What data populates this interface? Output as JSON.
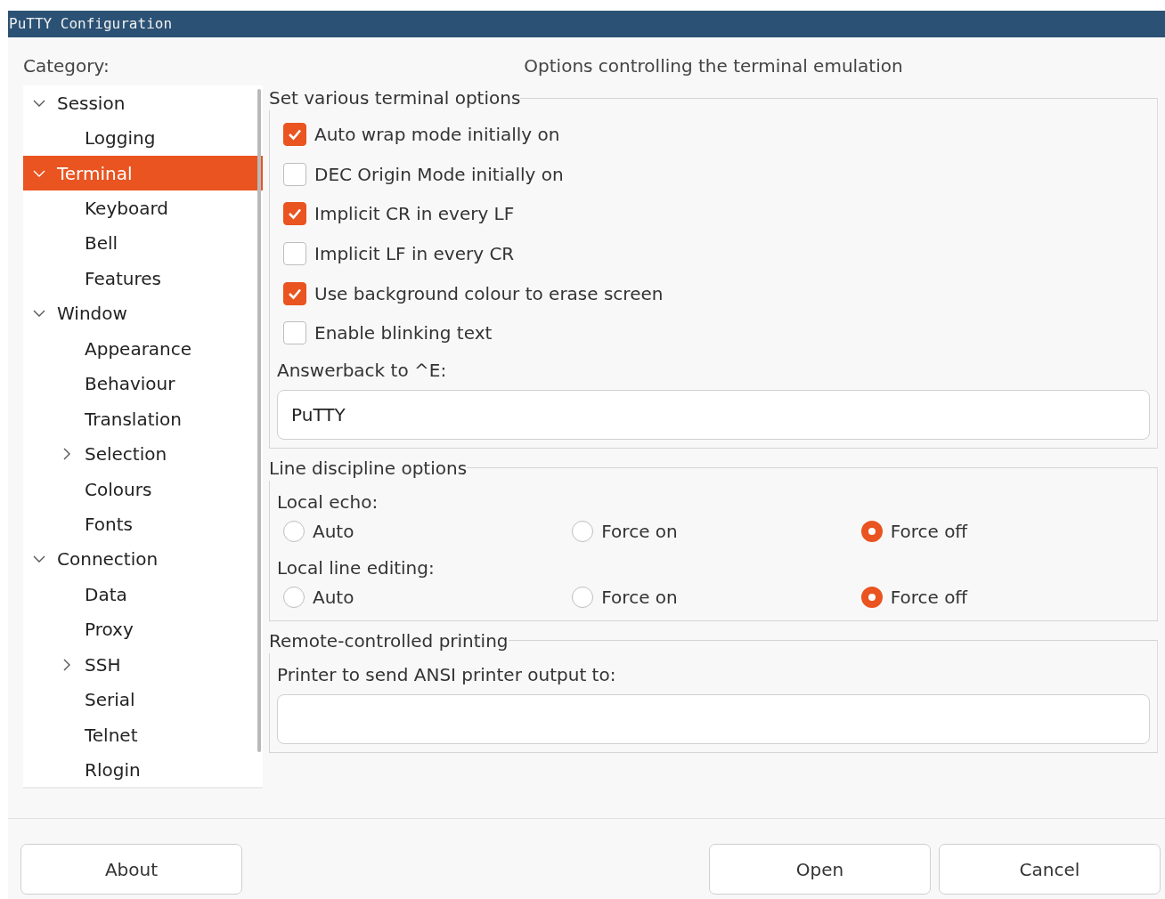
{
  "window": {
    "title": "PuTTY Configuration"
  },
  "category": {
    "label": "Category:",
    "items": [
      {
        "label": "Session",
        "selected": false,
        "expanded": true,
        "children": [
          {
            "label": "Logging",
            "selected": false
          }
        ]
      },
      {
        "label": "Terminal",
        "selected": true,
        "expanded": true,
        "children": [
          {
            "label": "Keyboard",
            "selected": false
          },
          {
            "label": "Bell",
            "selected": false
          },
          {
            "label": "Features",
            "selected": false
          }
        ]
      },
      {
        "label": "Window",
        "selected": false,
        "expanded": true,
        "children": [
          {
            "label": "Appearance",
            "selected": false
          },
          {
            "label": "Behaviour",
            "selected": false
          },
          {
            "label": "Translation",
            "selected": false
          },
          {
            "label": "Selection",
            "selected": false,
            "expanded": false
          },
          {
            "label": "Colours",
            "selected": false
          },
          {
            "label": "Fonts",
            "selected": false
          }
        ]
      },
      {
        "label": "Connection",
        "selected": false,
        "expanded": true,
        "children": [
          {
            "label": "Data",
            "selected": false
          },
          {
            "label": "Proxy",
            "selected": false
          },
          {
            "label": "SSH",
            "selected": false,
            "expanded": false
          },
          {
            "label": "Serial",
            "selected": false
          },
          {
            "label": "Telnet",
            "selected": false
          },
          {
            "label": "Rlogin",
            "selected": false
          }
        ]
      }
    ]
  },
  "panel": {
    "heading": "Options controlling the terminal emulation",
    "groups": [
      {
        "title": "Set various terminal options",
        "controls": [
          {
            "kind": "checkbox",
            "label": "Auto wrap mode initially on",
            "checked": true
          },
          {
            "kind": "checkbox",
            "label": "DEC Origin Mode initially on",
            "checked": false
          },
          {
            "kind": "checkbox",
            "label": "Implicit CR in every LF",
            "checked": true
          },
          {
            "kind": "checkbox",
            "label": "Implicit LF in every CR",
            "checked": false
          },
          {
            "kind": "checkbox",
            "label": "Use background colour to erase screen",
            "checked": true
          },
          {
            "kind": "checkbox",
            "label": "Enable blinking text",
            "checked": false
          },
          {
            "kind": "field",
            "label": "Answerback to ^E:",
            "value": "PuTTY"
          }
        ]
      },
      {
        "title": "Line discipline options",
        "controls": [
          {
            "kind": "radios",
            "label": "Local echo:",
            "options": [
              {
                "label": "Auto",
                "selected": false
              },
              {
                "label": "Force on",
                "selected": false
              },
              {
                "label": "Force off",
                "selected": true
              }
            ]
          },
          {
            "kind": "radios",
            "label": "Local line editing:",
            "options": [
              {
                "label": "Auto",
                "selected": false
              },
              {
                "label": "Force on",
                "selected": false
              },
              {
                "label": "Force off",
                "selected": true
              }
            ]
          }
        ]
      },
      {
        "title": "Remote-controlled printing",
        "controls": [
          {
            "kind": "field",
            "label": "Printer to send ANSI printer output to:"
          }
        ]
      }
    ]
  },
  "buttons_left": [
    "About"
  ],
  "buttons_right": [
    "Open",
    "Cancel"
  ]
}
